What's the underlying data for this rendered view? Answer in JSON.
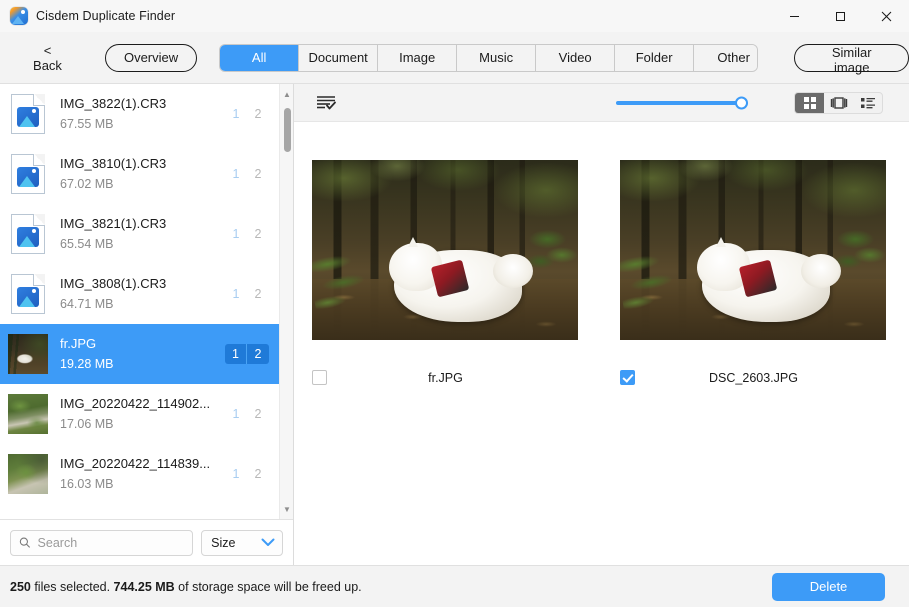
{
  "window": {
    "title": "Cisdem Duplicate Finder",
    "app_icon": "app-logo-icon",
    "minimize_label": "Minimize",
    "maximize_label": "Maximize",
    "close_label": "Close"
  },
  "toolbar": {
    "back_label": "< Back",
    "overview_label": "Overview",
    "similar_image_label": "Similar image",
    "tabs": [
      {
        "label": "All",
        "active": true
      },
      {
        "label": "Document",
        "active": false
      },
      {
        "label": "Image",
        "active": false
      },
      {
        "label": "Music",
        "active": false
      },
      {
        "label": "Video",
        "active": false
      },
      {
        "label": "Folder",
        "active": false
      },
      {
        "label": "Other",
        "active": false
      }
    ]
  },
  "sidebar": {
    "files": [
      {
        "name": "IMG_3822(1).CR3",
        "size": "67.55 MB",
        "count1": "1",
        "count2": "2",
        "icon": "document-image-icon",
        "selected": false
      },
      {
        "name": "IMG_3810(1).CR3",
        "size": "67.02 MB",
        "count1": "1",
        "count2": "2",
        "icon": "document-image-icon",
        "selected": false
      },
      {
        "name": "IMG_3821(1).CR3",
        "size": "65.54 MB",
        "count1": "1",
        "count2": "2",
        "icon": "document-image-icon",
        "selected": false
      },
      {
        "name": "IMG_3808(1).CR3",
        "size": "64.71 MB",
        "count1": "1",
        "count2": "2",
        "icon": "document-image-icon",
        "selected": false
      },
      {
        "name": "fr.JPG",
        "size": "19.28 MB",
        "count1": "1",
        "count2": "2",
        "icon": "photo-thumbnail-dog",
        "selected": true
      },
      {
        "name": "IMG_20220422_114902...",
        "size": "17.06 MB",
        "count1": "1",
        "count2": "2",
        "icon": "photo-thumbnail-garden",
        "selected": false
      },
      {
        "name": "IMG_20220422_114839...",
        "size": "16.03 MB",
        "count1": "1",
        "count2": "2",
        "icon": "photo-thumbnail-garden",
        "selected": false
      }
    ],
    "search": {
      "placeholder": "Search",
      "value": "",
      "icon": "search-icon"
    },
    "sort": {
      "selected": "Size",
      "chevron": "chevron-down-icon"
    },
    "scrollbar": {
      "up_arrow": "scroll-up-arrow-icon",
      "down_arrow": "scroll-down-arrow-icon"
    }
  },
  "main": {
    "select_all_icon": "select-all-list-icon",
    "zoom_slider": {
      "value": 100,
      "min": 0,
      "max": 100
    },
    "view_modes": [
      {
        "name": "grid-view-icon",
        "active": true
      },
      {
        "name": "coverflow-view-icon",
        "active": false
      },
      {
        "name": "list-view-icon",
        "active": false
      }
    ],
    "items": [
      {
        "filename": "fr.JPG",
        "checked": false,
        "image": "samoyed-dog-in-bamboo-forest"
      },
      {
        "filename": "DSC_2603.JPG",
        "checked": true,
        "image": "samoyed-dog-in-bamboo-forest"
      }
    ]
  },
  "status": {
    "count": "250",
    "files_selected_text": " files selected. ",
    "freed_size": "744.25 MB",
    "freed_text": " of storage space will be freed up.",
    "delete_label": "Delete"
  },
  "colors": {
    "accent": "#3d9bf7",
    "accent_dark": "#1f7ad8",
    "window_bg": "#f3f3f3",
    "panel_bg": "#ffffff"
  }
}
